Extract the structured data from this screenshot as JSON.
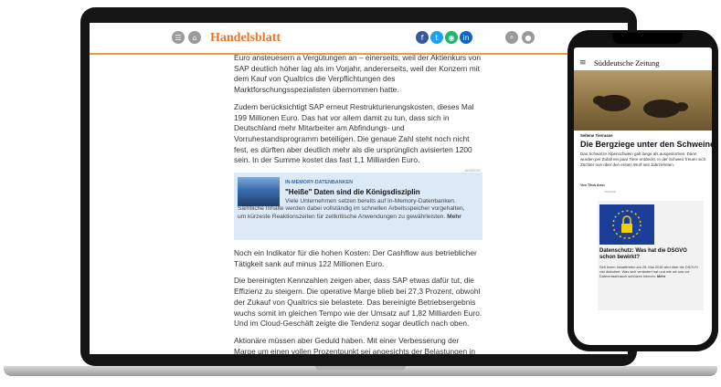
{
  "laptop": {
    "header": {
      "brand": "Handelsblatt",
      "social_icons": [
        "facebook-icon",
        "twitter-icon",
        "whatsapp-icon",
        "linkedin-icon"
      ],
      "colors": {
        "accent": "#e8772c",
        "facebook": "#3b5998",
        "twitter": "#1da1f2",
        "whatsapp": "#1fb76a",
        "linkedin": "#0a66c2",
        "grey": "#9a9a9a"
      }
    },
    "article": {
      "p1": "Euro ansteuesern a Vergütungen an – einerseits, weil der Aktienkurs von SAP deutlich höher lag als im Vorjahr, andererseits, weil der Konzern mit dem Kauf von Qualtrics die Verpflichtungen des Marktforschungsspezialisten übernommen hatte.",
      "p2": "Zudem berücksichtigt SAP erneut Restrukturierungskosten, dieses Mal 199 Millionen Euro. Das hat vor allem damit zu tun, dass sich in Deutschland mehr Mitarbeiter am Abfindungs- und Vorruhestandsprogramm beteiligen. Die genaue Zahl steht noch nicht fest, es dürften aber deutlich mehr als die ursprünglich avisierten 1200 sein. In der Summe kostet das fast 1,1 Milliarden Euro.",
      "promo": {
        "label": "ANZEIGE",
        "kicker": "IN-MEMORY-DATENBANKEN",
        "title": "\"Heiße\" Daten sind die Königsdisziplin",
        "text": "Viele Unternehmen setzen bereits auf In-Memory-Datenbanken. Sämtliche Inhalte werden dabei vollständig im schnellen Arbeitsspeicher vorgehalten, um kürzeste Reaktionszeiten für zeitkritische Anwendungen zu gewährleisten.",
        "more": "Mehr"
      },
      "p3": "Noch ein Indikator für die hohen Kosten: Der Cashflow aus betrieblicher Tätigkeit sank auf minus 122 Millionen Euro.",
      "p4": "Die bereinigten Kennzahlen zeigen aber, dass SAP etwas dafür tut, die Effizienz zu steigern. Die operative Marge blieb bei 27,3 Prozent, obwohl der Zukauf von Qualtrics sie belastete. Das bereinigte Betriebsergebnis wuchs somit im gleichen Tempo wie der Umsatz auf 1,82 Milliarden Euro. Und im Cloud-Geschäft zeigte die Tendenz sogar deutlich nach oben.",
      "p5": "Aktionäre müssen aber Geduld haben. Mit einer Verbesserung der Marge um einen vollen Prozentpunkt sei angesichts der Belastungen in diesem"
    }
  },
  "phone": {
    "brand": "Süddeutsche Zeitung",
    "kicker": "Seltene Tierrasse",
    "title": "Die Bergziege unter den Schweinen",
    "text": "Das Schwarze Alpenschwein galt lange als ausgestorben. Dann wurden per Zufall ein paar Tiere entdeckt. In der Schweiz freuen sich Züchter nun über den ersten Wurf seit Jahrzehnten.",
    "author": "Von Titus Arnu",
    "ad_label": "ANZEIGE",
    "card": {
      "title": "Datenschutz: Was hat die DSGVO schon bewirkt?",
      "text": "Seit ihrem Inkrafttreten am 25. Mai 2018 wird über die DSGVO viel diskutiert. Was sich verändert hat und wie wir uns vor Datenmissbrauch schützen können.",
      "more": "Mehr"
    }
  }
}
